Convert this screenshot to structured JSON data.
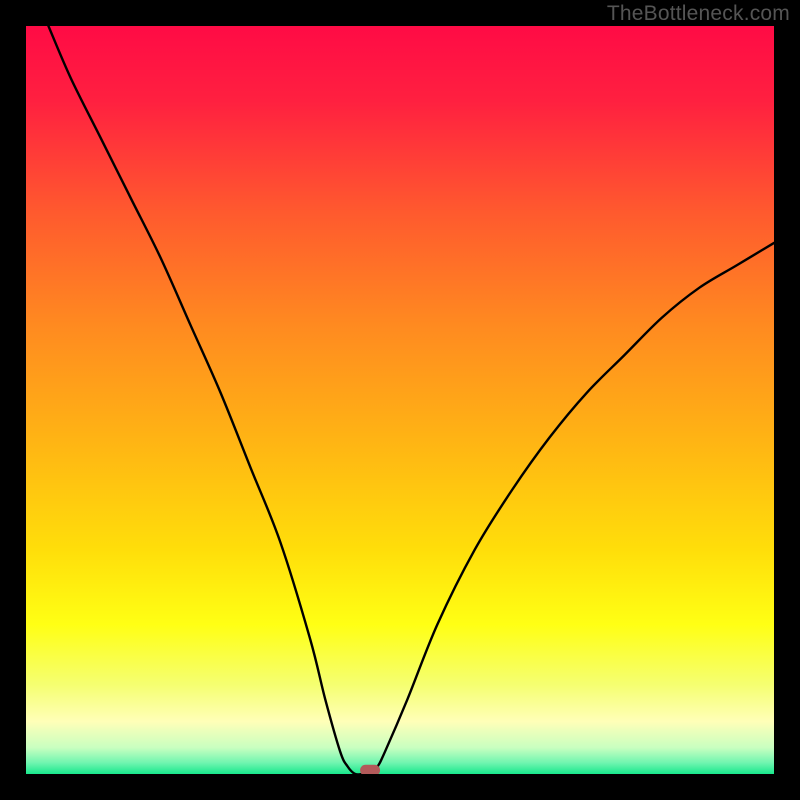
{
  "watermark": {
    "text": "TheBottleneck.com"
  },
  "chart_data": {
    "type": "line",
    "title": "",
    "xlabel": "",
    "ylabel": "",
    "xlim": [
      0,
      100
    ],
    "ylim": [
      0,
      100
    ],
    "series": [
      {
        "name": "bottleneck-curve",
        "x": [
          3,
          6,
          10,
          14,
          18,
          22,
          26,
          30,
          34,
          38,
          40,
          42,
          43,
          44,
          45,
          46,
          47,
          48,
          51,
          55,
          60,
          65,
          70,
          75,
          80,
          85,
          90,
          95,
          100
        ],
        "y": [
          100,
          93,
          85,
          77,
          69,
          60,
          51,
          41,
          31,
          18,
          10,
          3,
          1,
          0,
          0,
          0,
          1,
          3,
          10,
          20,
          30,
          38,
          45,
          51,
          56,
          61,
          65,
          68,
          71
        ]
      }
    ],
    "marker": {
      "x": 46,
      "y": 0.5
    },
    "gradient_stops": [
      {
        "offset": 0.0,
        "color": "#ff0b45"
      },
      {
        "offset": 0.1,
        "color": "#ff2040"
      },
      {
        "offset": 0.25,
        "color": "#ff5a2e"
      },
      {
        "offset": 0.4,
        "color": "#ff8a20"
      },
      {
        "offset": 0.55,
        "color": "#ffb314"
      },
      {
        "offset": 0.7,
        "color": "#ffde0a"
      },
      {
        "offset": 0.8,
        "color": "#ffff14"
      },
      {
        "offset": 0.88,
        "color": "#f5ff70"
      },
      {
        "offset": 0.93,
        "color": "#ffffb8"
      },
      {
        "offset": 0.965,
        "color": "#c8ffc0"
      },
      {
        "offset": 0.985,
        "color": "#70f5b0"
      },
      {
        "offset": 1.0,
        "color": "#18e88c"
      }
    ],
    "marker_color": "#b35a5a"
  }
}
